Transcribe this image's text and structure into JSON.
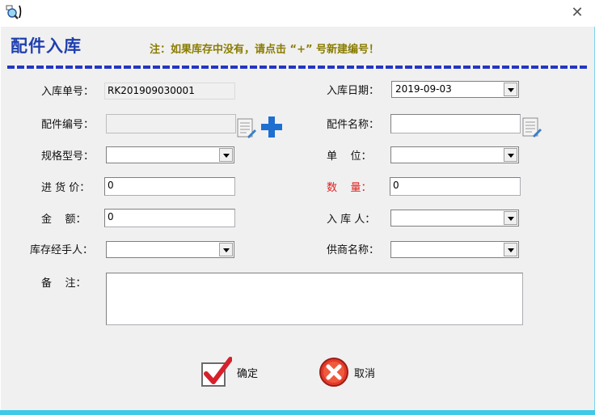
{
  "window": {
    "icon": "app-magnifier-icon",
    "close_icon": "close-icon",
    "heading": "配件入库",
    "notice": "注：如果库存中没有，请点击 “+” 号新建编号！"
  },
  "form": {
    "receipt_no": {
      "label": "入库单号：",
      "value": "RK201909030001"
    },
    "receipt_date": {
      "label": "入库日期：",
      "value": "2019-09-03"
    },
    "part_code": {
      "label": "配件编号：",
      "value": ""
    },
    "part_name": {
      "label": "配件名称：",
      "value": ""
    },
    "spec_model": {
      "label": "规格型号：",
      "value": ""
    },
    "unit": {
      "label": "单    位：",
      "value": ""
    },
    "purchase_price": {
      "label": "进 货 价：",
      "value": "0"
    },
    "quantity": {
      "label": "数    量：",
      "value": "0"
    },
    "amount": {
      "label": "金    额：",
      "value": "0"
    },
    "receiver": {
      "label": "入 库 人：",
      "value": ""
    },
    "stock_handler": {
      "label": "库存经手人：",
      "value": ""
    },
    "supplier": {
      "label": "供商名称：",
      "value": ""
    },
    "remarks": {
      "label": "备    注：",
      "value": ""
    }
  },
  "buttons": {
    "confirm": {
      "label": "确定",
      "icon": "checkmark-icon"
    },
    "cancel": {
      "label": "取消",
      "icon": "cancel-x-icon"
    }
  },
  "colors": {
    "heading": "#1f3fae",
    "notice": "#8a7c00",
    "required_label": "#e02020",
    "accent_plus": "#1e6fd0"
  }
}
